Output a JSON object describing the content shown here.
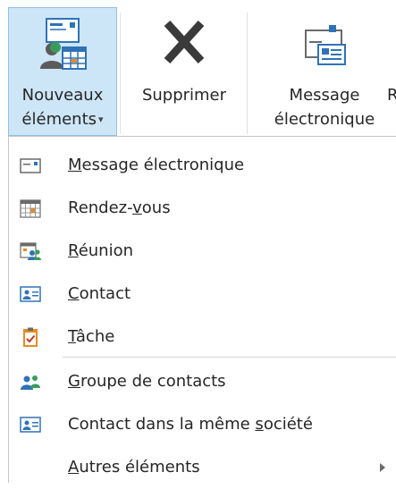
{
  "ribbon": {
    "new_items": {
      "line1": "Nouveaux",
      "line2": "éléments",
      "caret": "▾",
      "icon": "new-items-icon"
    },
    "delete": {
      "label": "Supprimer",
      "icon": "delete-x-icon"
    },
    "email": {
      "line1": "Message",
      "line2": "électronique",
      "icon": "email-message-icon"
    },
    "overflow": "R"
  },
  "menu": {
    "items": [
      {
        "pre": "",
        "acc": "M",
        "post": "essage électronique",
        "icon": "email-message-icon"
      },
      {
        "pre": "Rendez-",
        "acc": "v",
        "post": "ous",
        "icon": "calendar-icon"
      },
      {
        "pre": "",
        "acc": "R",
        "post": "éunion",
        "icon": "meeting-icon"
      },
      {
        "pre": "",
        "acc": "C",
        "post": "ontact",
        "icon": "contact-card-icon"
      },
      {
        "pre": "",
        "acc": "T",
        "post": "âche",
        "icon": "task-icon"
      },
      {
        "pre": "",
        "acc": "G",
        "post": "roupe de contacts",
        "icon": "contact-group-icon"
      },
      {
        "pre": "Contact dans la même ",
        "acc": "s",
        "post": "ociété",
        "icon": "contact-card-icon"
      },
      {
        "pre": "",
        "acc": "A",
        "post": "utres éléments",
        "icon": "",
        "submenu": true
      }
    ]
  },
  "colors": {
    "selected_button_bg": "#cde6f7",
    "selected_button_border": "#92c0e0",
    "icon_blue": "#2f73b7",
    "task_orange": "#e58b1f",
    "group_green": "#3a9a5c"
  }
}
